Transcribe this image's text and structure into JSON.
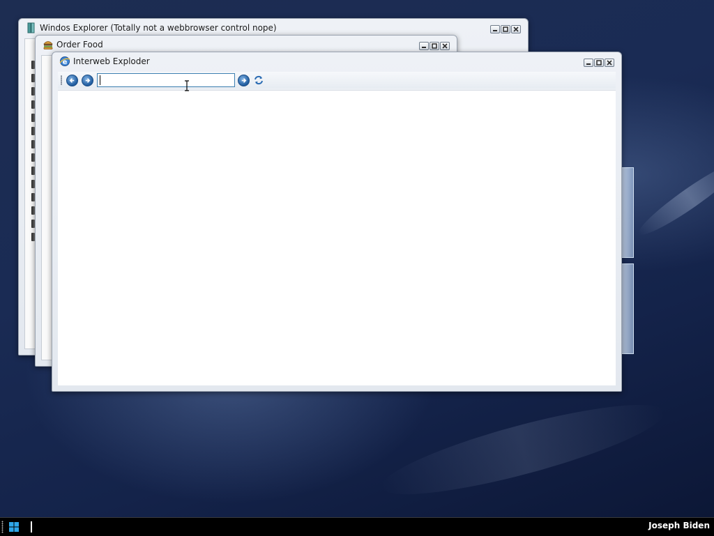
{
  "desktop": {
    "windows": {
      "explorer": {
        "title": "Windos Explorer (Totally not a webbrowser control nope)",
        "icon": "explorer-icon"
      },
      "order_food": {
        "title": "Order Food",
        "icon": "burger-icon"
      },
      "interweb_exploder": {
        "title": "Interweb Exploder",
        "icon": "ie-icon",
        "address_bar": {
          "value": "",
          "placeholder": ""
        },
        "toolbar_icons": [
          "back-arrow-icon",
          "forward-arrow-icon",
          "go-arrow-icon",
          "refresh-icon"
        ]
      }
    }
  },
  "taskbar": {
    "start_icon": "windows-logo-icon",
    "user_name": "Joseph Biden"
  },
  "colors": {
    "desktop_dark": "#14234a",
    "taskbar_bg": "#000000",
    "accent_blue": "#1f5b9e"
  }
}
